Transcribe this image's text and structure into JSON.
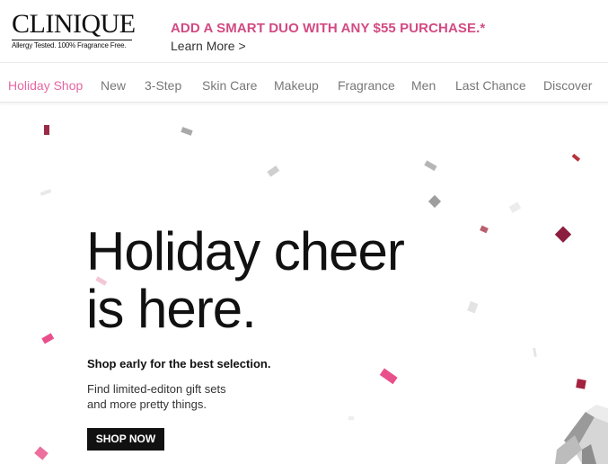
{
  "brand": {
    "logo_text": "CLINIQUE",
    "tagline": "Allergy Tested. 100% Fragrance Free."
  },
  "promo": {
    "title": "ADD A SMART DUO WITH ANY $55 PURCHASE.*",
    "link": "Learn More >"
  },
  "nav": {
    "items": [
      {
        "label": "Holiday Shop",
        "active": true
      },
      {
        "label": "New"
      },
      {
        "label": "3-Step"
      },
      {
        "label": "Skin Care"
      },
      {
        "label": "Makeup"
      },
      {
        "label": "Fragrance"
      },
      {
        "label": "Men"
      },
      {
        "label": "Last Chance"
      },
      {
        "label": "Discover"
      }
    ]
  },
  "hero": {
    "headline_line1": "Holiday cheer",
    "headline_line2": "is here.",
    "subhead": "Shop early for the best selection.",
    "body_line1": "Find limited-editon gift sets",
    "body_line2": "and more pretty things.",
    "cta": "SHOP NOW"
  },
  "colors": {
    "accent_pink": "#d24a83",
    "nav_active": "#e567a3",
    "confetti_burgundy": "#8b1e3f",
    "confetti_pink": "#e8508c",
    "confetti_silver": "#b9b9b9"
  }
}
